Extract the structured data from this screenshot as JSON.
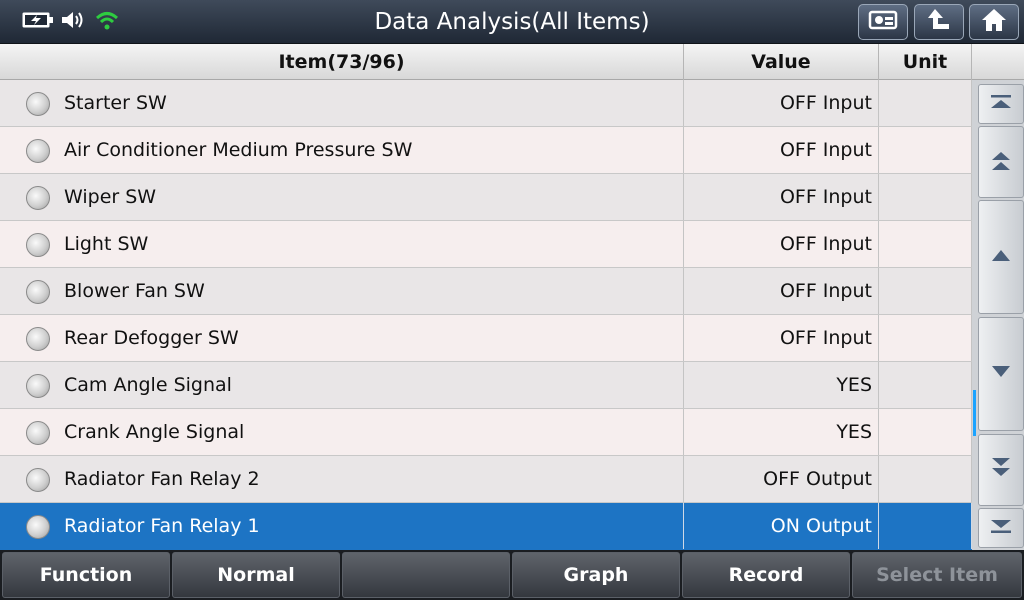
{
  "title": "Data Analysis(All Items)",
  "header": {
    "item": "Item(73/96)",
    "value": "Value",
    "unit": "Unit"
  },
  "rows": [
    {
      "item": "Starter SW",
      "value": "OFF Input",
      "unit": ""
    },
    {
      "item": "Air Conditioner Medium Pressure SW",
      "value": "OFF Input",
      "unit": ""
    },
    {
      "item": "Wiper SW",
      "value": "OFF Input",
      "unit": ""
    },
    {
      "item": "Light SW",
      "value": "OFF Input",
      "unit": ""
    },
    {
      "item": "Blower Fan SW",
      "value": "OFF Input",
      "unit": ""
    },
    {
      "item": "Rear Defogger SW",
      "value": "OFF Input",
      "unit": ""
    },
    {
      "item": "Cam Angle Signal",
      "value": "YES",
      "unit": ""
    },
    {
      "item": "Crank Angle Signal",
      "value": "YES",
      "unit": ""
    },
    {
      "item": "Radiator Fan Relay 2",
      "value": "OFF Output",
      "unit": ""
    },
    {
      "item": "Radiator Fan Relay 1",
      "value": "ON Output",
      "unit": "",
      "selected": true
    }
  ],
  "bottom": {
    "function": "Function",
    "normal": "Normal",
    "blank": "",
    "graph": "Graph",
    "record": "Record",
    "select_item": "Select Item"
  },
  "icons": {
    "battery": "battery-icon",
    "volume": "volume-icon",
    "wifi": "wifi-icon",
    "screenshot": "screenshot-icon",
    "back": "back-icon",
    "home": "home-icon"
  },
  "colors": {
    "selected_row": "#1d74c4",
    "wifi": "#2ecc40",
    "scroll_thumb": "#1aa3ff"
  }
}
